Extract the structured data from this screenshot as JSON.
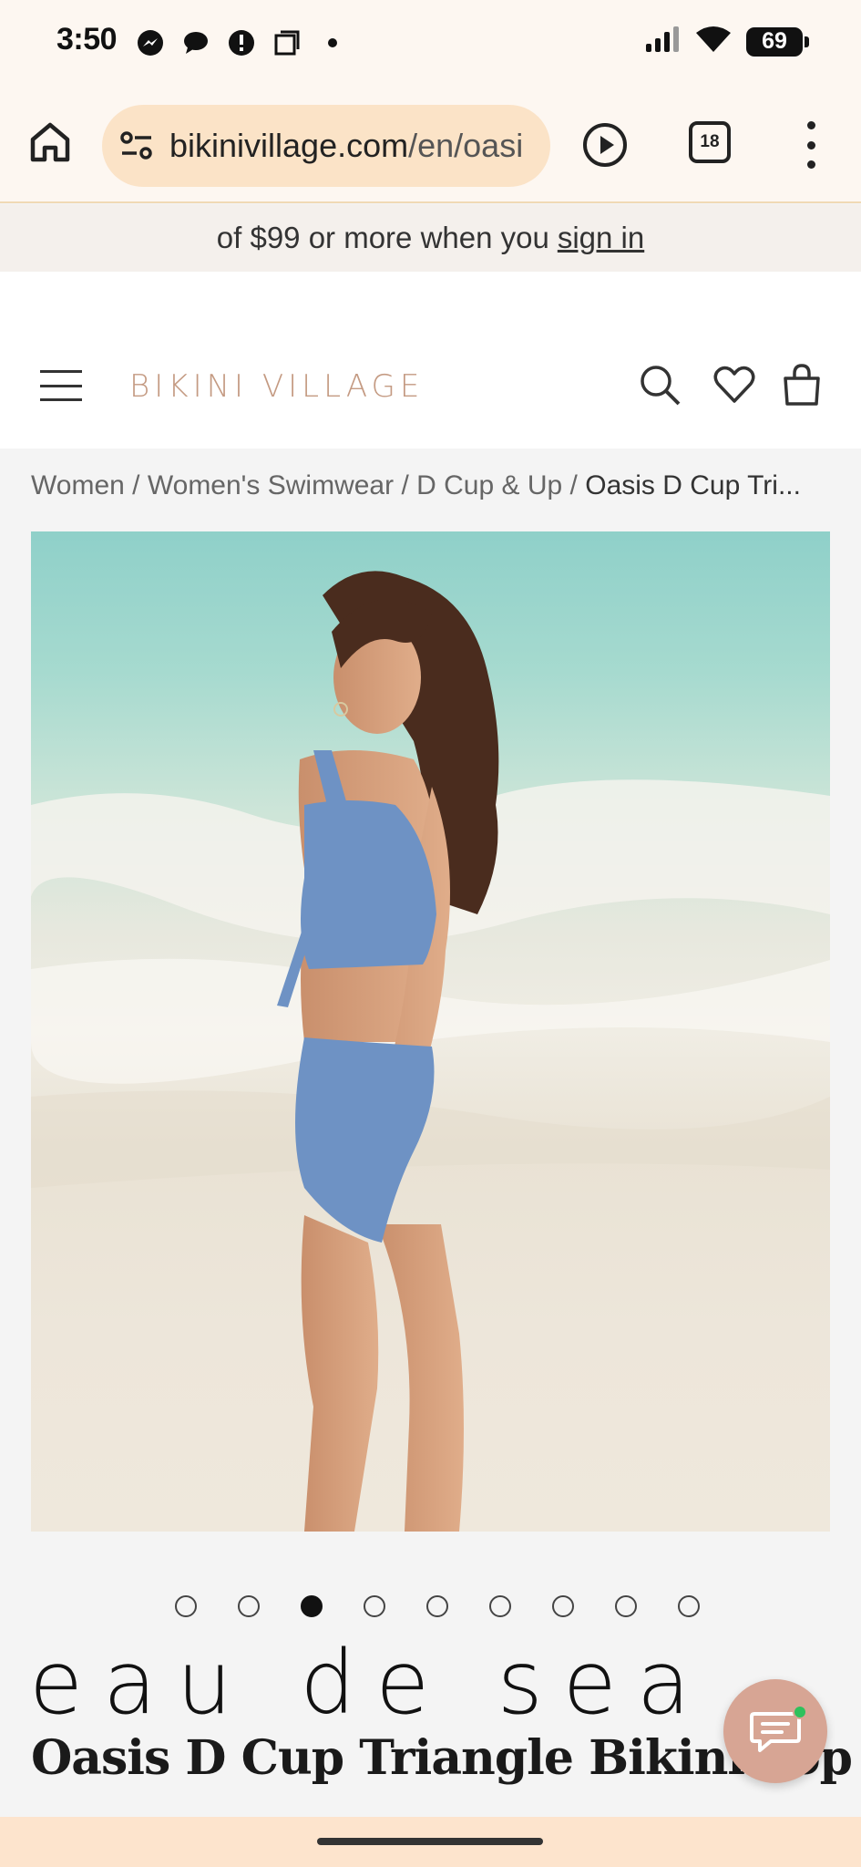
{
  "status_bar": {
    "time": "3:50",
    "battery": "69",
    "left_icons": [
      "messenger-icon",
      "chat-icon",
      "alert-icon",
      "copy-icon",
      "dot-icon"
    ],
    "right_icons": [
      "signal-icon",
      "wifi-icon",
      "battery-icon"
    ]
  },
  "browser": {
    "url_host": "bikinivillage.com",
    "url_path": "/en/oasi",
    "tab_count": "18"
  },
  "promo": {
    "text": "of $99 or more when you",
    "link": "sign in"
  },
  "header": {
    "logo": "BIKINI VILLAGE"
  },
  "breadcrumb": {
    "items": [
      "Women",
      "Women's Swimwear",
      "D Cup & Up"
    ],
    "separator": "/",
    "current": "Oasis D Cup Tri..."
  },
  "carousel": {
    "count": 9,
    "active_index": 2
  },
  "product": {
    "brand": "eau de sea",
    "title": "Oasis D Cup Triangle Bikini Top"
  },
  "colors": {
    "logo": "#c49a82",
    "url_pill": "#fbe3c7",
    "chat_button": "#d7a594",
    "swimsuit": "#6e92c4"
  }
}
